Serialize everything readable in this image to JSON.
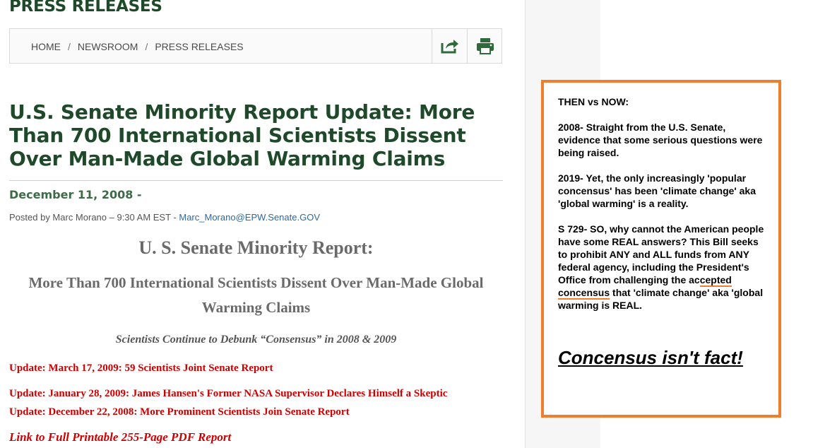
{
  "page": {
    "section_heading": "PRESS RELEASES",
    "breadcrumb": {
      "home": "HOME",
      "newsroom": "NEWSROOM",
      "current": "PRESS RELEASES"
    },
    "icons": {
      "share": "share-icon",
      "print": "printer-icon"
    }
  },
  "article": {
    "title": "U.S. Senate Minority Report Update: More Than 700 International Scientists Dissent Over Man-Made Global Warming Claims",
    "date": "December 11, 2008 -",
    "byline_prefix": "Posted by Marc Morano – 9:30 AM EST - ",
    "byline_email": "Marc_Morano@EPW.Senate.GOV",
    "report_title": "U. S. Senate Minority Report:",
    "report_subtitle": "More Than 700 International Scientists Dissent Over Man-Made Global Warming Claims",
    "tagline": "Scientists Continue to Debunk “Consensus” in 2008 & 2009",
    "updates": [
      "Update: March 17, 2009: 59 Scientists Joint Senate Report",
      "Update: January 28, 2009: James Hansen's Former NASA Supervisor Declares Himself a Skeptic",
      "Update: December 22, 2008: More Prominent Scientists Join Senate Report"
    ],
    "pdf_link": "Link to Full Printable 255-Page PDF Report"
  },
  "note": {
    "title": "THEN vs NOW:",
    "p1": "2008- Straight from the U.S. Senate, evidence that some serious questions were being raised.",
    "p2": "2019- Yet, the only increasingly 'popular concensus' has been 'climate change' aka 'global warming' is a reality.",
    "p3_before": " S 729- SO, why cannot the American people have some REAL answers? This Bill seeks to prohibit ANY and ALL funds from ANY federal agency, including the President's Office from challenging the ac",
    "p3_highlight": "cepted concensus",
    "p3_after": " that 'climate change' aka 'global warming is REAL.",
    "conclusion": "Concensus isn't fact!"
  },
  "colors": {
    "heading_green": "#1f4a2a",
    "date_green": "#3d6b47",
    "link_red": "#cc0000",
    "note_border": "#ef7f2e",
    "link_blue": "#2d6aa0"
  }
}
